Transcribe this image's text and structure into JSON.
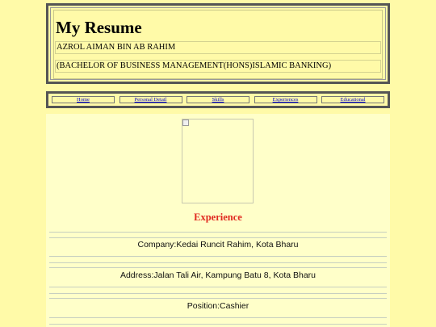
{
  "header": {
    "title": "My Resume",
    "name": "AZROL AIMAN BIN AB RAHIM",
    "degree": "(BACHELOR OF BUSINESS MANAGEMENT(HONS)ISLAMIC BANKING)"
  },
  "nav": {
    "items": [
      "Home",
      "Personal Detail",
      "Skills",
      "Experiences",
      "Educational"
    ]
  },
  "main": {
    "photo_icon": "broken-image-icon",
    "section_title": "Experience",
    "company": "Company:Kedai Runcit Rahim, Kota Bharu",
    "address": "Address:Jalan Tali Air, Kampung Batu 8, Kota Bharu",
    "position": "Position:Cashier"
  },
  "colors": {
    "background": "#fffaa8",
    "content_bg": "#ffffc9",
    "section_title": "#e0281f",
    "link": "#0000cc"
  }
}
